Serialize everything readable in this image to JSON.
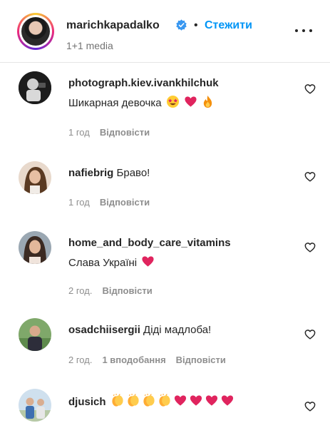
{
  "header": {
    "username": "marichkapadalko",
    "separator": "•",
    "follow_label": "Стежити",
    "subtitle": "1+1 media",
    "verified_icon": "verified-badge-icon",
    "more_icon": "more-options-icon"
  },
  "comments": [
    {
      "username": "photograph.kiev.ivankhilchuk",
      "text": "Шикарная девочка",
      "emoji": [
        "star-struck",
        "red-heart",
        "fire"
      ],
      "time": "1 год",
      "reply_label": "Відповісти"
    },
    {
      "username": "nafiebrig",
      "text": "Браво!",
      "emoji": [],
      "time": "1 год",
      "reply_label": "Відповісти"
    },
    {
      "username": "home_and_body_care_vitamins",
      "text": "Слава Україні",
      "emoji": [
        "red-heart"
      ],
      "time": "2 год.",
      "reply_label": "Відповісти"
    },
    {
      "username": "osadchiisergii",
      "text": "Діді мадлоба!",
      "emoji": [],
      "time": "2 год.",
      "likes": "1 вподобання",
      "reply_label": "Відповісти"
    },
    {
      "username": "djusich",
      "text": "",
      "emoji": [
        "clapping-hands",
        "clapping-hands",
        "clapping-hands",
        "clapping-hands",
        "red-heart",
        "red-heart",
        "red-heart",
        "red-heart"
      ]
    }
  ],
  "colors": {
    "follow_blue": "#0095f6",
    "verified_blue": "#3897f0",
    "meta_gray": "#8e8e8e",
    "heart_red": "#e0245e"
  }
}
